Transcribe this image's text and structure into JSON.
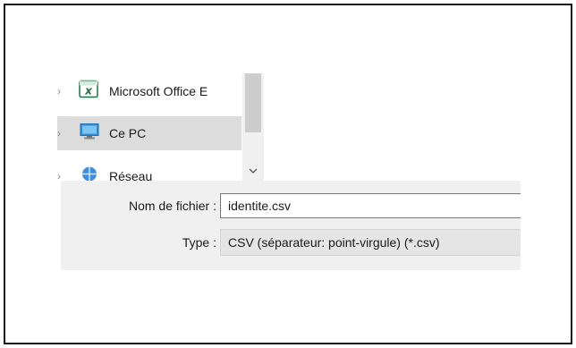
{
  "nav": {
    "items": [
      {
        "label": "Microsoft Office E",
        "icon": "excel-icon"
      },
      {
        "label": "Ce PC",
        "icon": "computer-icon",
        "selected": true
      },
      {
        "label": "Réseau",
        "icon": "network-icon"
      }
    ]
  },
  "form": {
    "filename_label": "Nom de fichier :",
    "filename_value": "identite.csv",
    "type_label": "Type :",
    "type_value": "CSV (séparateur: point-virgule) (*.csv)"
  },
  "colors": {
    "selected_bg": "#dcdcdc",
    "panel_bg": "#f0f0f0",
    "excel_green": "#1e7145"
  }
}
